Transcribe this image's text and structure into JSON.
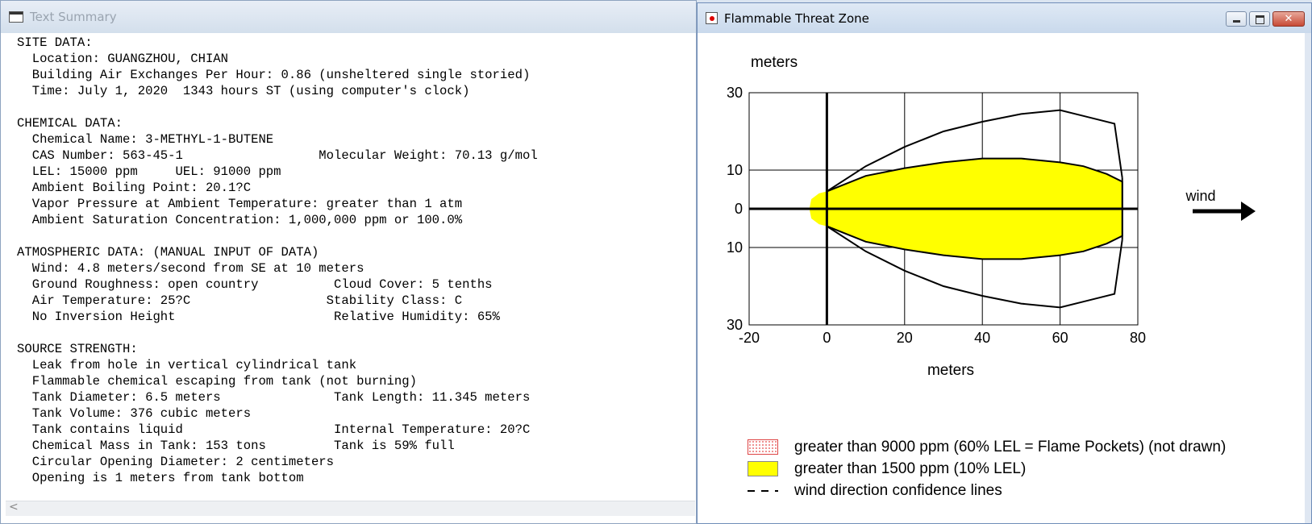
{
  "text_summary": {
    "title": "Text Summary",
    "body": "SITE DATA:\n  Location: GUANGZHOU, CHIAN\n  Building Air Exchanges Per Hour: 0.86 (unsheltered single storied)\n  Time: July 1, 2020  1343 hours ST (using computer's clock)\n\nCHEMICAL DATA:\n  Chemical Name: 3-METHYL-1-BUTENE\n  CAS Number: 563-45-1                  Molecular Weight: 70.13 g/mol\n  LEL: 15000 ppm     UEL: 91000 ppm\n  Ambient Boiling Point: 20.1?C\n  Vapor Pressure at Ambient Temperature: greater than 1 atm\n  Ambient Saturation Concentration: 1,000,000 ppm or 100.0%\n\nATMOSPHERIC DATA: (MANUAL INPUT OF DATA)\n  Wind: 4.8 meters/second from SE at 10 meters\n  Ground Roughness: open country          Cloud Cover: 5 tenths\n  Air Temperature: 25?C                  Stability Class: C\n  No Inversion Height                     Relative Humidity: 65%\n\nSOURCE STRENGTH:\n  Leak from hole in vertical cylindrical tank\n  Flammable chemical escaping from tank (not burning)\n  Tank Diameter: 6.5 meters               Tank Length: 11.345 meters\n  Tank Volume: 376 cubic meters\n  Tank contains liquid                    Internal Temperature: 20?C\n  Chemical Mass in Tank: 153 tons         Tank is 59% full\n  Circular Opening Diameter: 2 centimeters\n  Opening is 1 meters from tank bottom",
    "scroll_arrow": "<"
  },
  "threat_zone": {
    "title": "Flammable Threat Zone",
    "window_buttons": {
      "close": "✕"
    },
    "y_unit_label": "meters",
    "x_unit_label": "meters",
    "wind_label": "wind",
    "legend": [
      {
        "label": "greater than 9000 ppm (60% LEL = Flame Pockets) (not drawn)",
        "swatch": "flame"
      },
      {
        "label": "greater than 1500 ppm (10% LEL)",
        "swatch": "yellow"
      },
      {
        "label": "wind direction confidence lines",
        "swatch": "dash"
      }
    ],
    "colors": {
      "zone_fill": "#ffff00",
      "axis": "#000000"
    }
  },
  "chart_data": {
    "type": "area",
    "xlabel": "meters",
    "ylabel": "meters",
    "xlim": [
      -20,
      80
    ],
    "ylim": [
      -30,
      30
    ],
    "x_tick_labels": [
      "-20",
      "0",
      "20",
      "40",
      "60",
      "80"
    ],
    "y_tick_labels": [
      "30",
      "10",
      "0",
      "10",
      "30"
    ],
    "y_ticks": [
      30,
      10,
      0,
      -10,
      -30
    ],
    "grid": true,
    "series": [
      {
        "name": "greater than 1500 ppm (10% LEL)",
        "x": [
          -4.5,
          -4,
          -2,
          0,
          5,
          10,
          20,
          30,
          40,
          50,
          60,
          66,
          72,
          76
        ],
        "y_upper": [
          0,
          2.5,
          4,
          4.5,
          6.5,
          8.5,
          10.5,
          12,
          13,
          13,
          12,
          11,
          9,
          7
        ],
        "y_lower": [
          0,
          -2.5,
          -4,
          -4.5,
          -6.5,
          -8.5,
          -10.5,
          -12,
          -13,
          -13,
          -12,
          -11,
          -9,
          -7
        ]
      },
      {
        "name": "wind direction confidence lines",
        "x": [
          0,
          10,
          20,
          30,
          40,
          50,
          60,
          66,
          74,
          76
        ],
        "y_upper": [
          4.5,
          11,
          16,
          20,
          22.5,
          24.5,
          25.5,
          24,
          22,
          8
        ],
        "y_lower": [
          -4.5,
          -11,
          -16,
          -20,
          -22.5,
          -24.5,
          -25.5,
          -24,
          -22,
          -8
        ]
      }
    ]
  }
}
